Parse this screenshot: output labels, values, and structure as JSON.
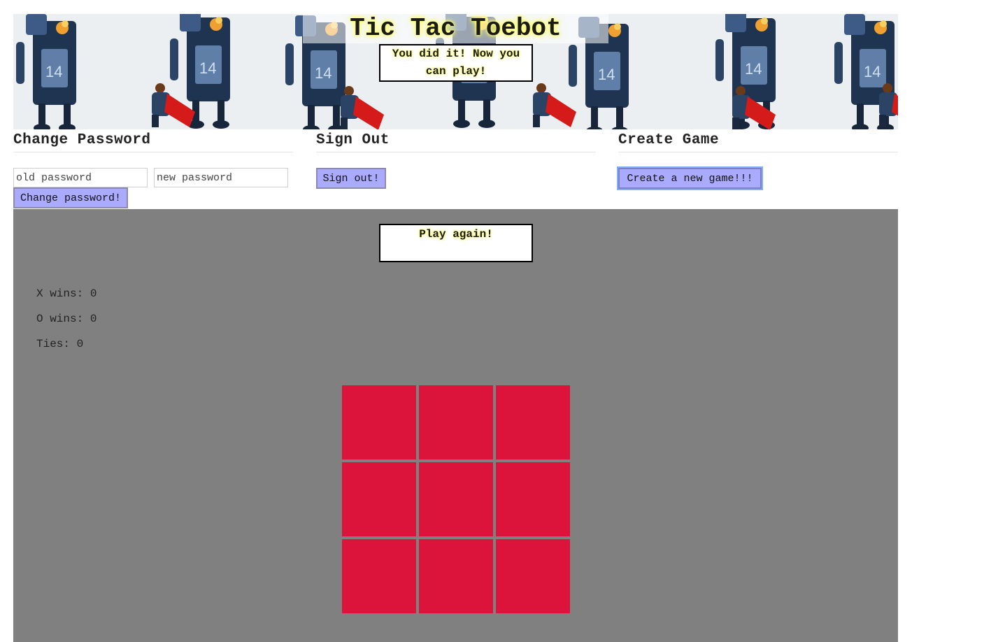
{
  "header": {
    "title": "Tic Tac Toebot",
    "message": "You did it! Now you can play!"
  },
  "change_password": {
    "heading": "Change Password",
    "old_placeholder": "old password",
    "new_placeholder": "new password",
    "button": "Change password!"
  },
  "sign_out": {
    "heading": "Sign Out",
    "button": "Sign out!"
  },
  "create_game": {
    "heading": "Create Game",
    "button": "Create a new game!!!"
  },
  "game": {
    "play_again": "Play again!",
    "x_wins": "X wins: 0",
    "o_wins": "O wins: 0",
    "ties": "Ties: 0",
    "cells": [
      "",
      "",
      "",
      "",
      "",
      "",
      "",
      "",
      ""
    ],
    "cell_color": "#dc143c",
    "background": "#808080"
  },
  "colors": {
    "button_bg": "#aaaaff",
    "title_glow": "#ffff66"
  }
}
